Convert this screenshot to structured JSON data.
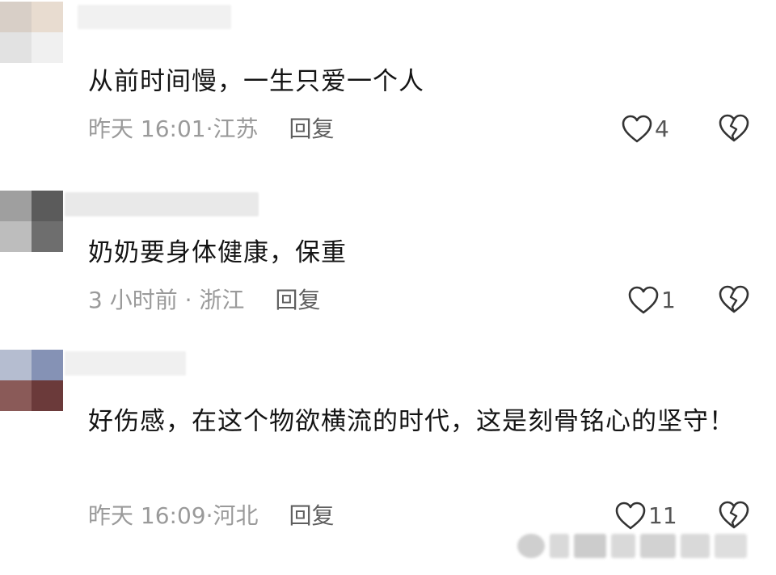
{
  "comments": [
    {
      "text": "从前时间慢，一生只爱一个人",
      "time": "昨天 16:01",
      "location": "江苏",
      "reply_label": "回复",
      "likes": "4",
      "avatar_colors": [
        "#d8cfc7",
        "#e8dcd0",
        "#e2e2e2",
        "#f0f0f0"
      ]
    },
    {
      "text": "奶奶要身体健康，保重",
      "time": "3 小时前",
      "location": "浙江",
      "reply_label": "回复",
      "likes": "1",
      "avatar_colors": [
        "#9f9f9f",
        "#5b5b5b",
        "#bdbdbd",
        "#6e6e6e"
      ]
    },
    {
      "text": "好伤感，在这个物欲横流的时代，这是刻骨铭心的坚守！",
      "time": "昨天 16:09",
      "location": "河北",
      "reply_label": "回复",
      "likes": "11",
      "avatar_colors": [
        "#b5bdd0",
        "#8592b5",
        "#8a5a58",
        "#6b3a3a"
      ]
    }
  ],
  "icons": {
    "like": "heart-outline-icon",
    "dislike": "broken-heart-icon"
  },
  "colors": {
    "text": "#141414",
    "meta": "#9a9a9a",
    "reply": "#5f5f5f",
    "icon": "#333333"
  }
}
